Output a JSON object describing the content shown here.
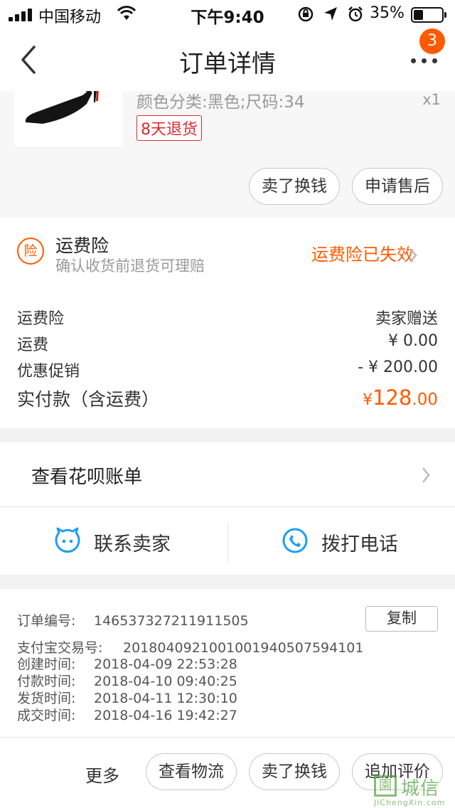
{
  "status_bar": {
    "carrier": "中国移动",
    "time": "下午9:40",
    "battery_percent": "35%",
    "battery_level": 0.35
  },
  "nav": {
    "title": "订单详情",
    "badge_count": "3"
  },
  "product": {
    "attributes": "颜色分类:黑色;尺码:34",
    "quantity": "x1",
    "return_policy": "8天退货",
    "buttons": {
      "sell_exchange": "卖了换钱",
      "after_sale": "申请售后"
    }
  },
  "insurance": {
    "icon_char": "险",
    "title": "运费险",
    "subtitle": "确认收货前退货可理赔",
    "status": "运费险已失效"
  },
  "cost_summary": {
    "rows": [
      {
        "label": "运费险",
        "value": "卖家赠送"
      },
      {
        "label": "运费",
        "value": "¥ 0.00"
      },
      {
        "label": "优惠促销",
        "value": "- ¥ 200.00"
      }
    ],
    "total": {
      "label": "实付款（含运费）",
      "currency": "¥",
      "integer": "128",
      "decimal": ".00"
    }
  },
  "huabei": {
    "label": "查看花呗账单"
  },
  "contact": {
    "seller": "联系卖家",
    "phone": "拨打电话"
  },
  "order_info": {
    "order_no_label": "订单编号:",
    "order_no": "146537327211911505",
    "copy_label": "复制",
    "alipay_label": "支付宝交易号:",
    "alipay_no": "2018040921001001940507594101",
    "created_label": "创建时间:",
    "created": "2018-04-09 22:53:28",
    "paid_label": "付款时间:",
    "paid": "2018-04-10 09:40:25",
    "shipped_label": "发货时间:",
    "shipped": "2018-04-11 12:30:10",
    "completed_label": "成交时间:",
    "completed": "2018-04-16 19:42:27"
  },
  "actions": {
    "more": "更多",
    "logistics": "查看物流",
    "sell_exchange": "卖了换钱",
    "add_review": "追加评价"
  },
  "watermark": {
    "box_char": "園",
    "text": "城信",
    "url": "JiChengXin.com"
  },
  "colors": {
    "accent": "#ff5a00",
    "return_badge": "#e0282e",
    "contact_icon": "#1a9ff0"
  }
}
